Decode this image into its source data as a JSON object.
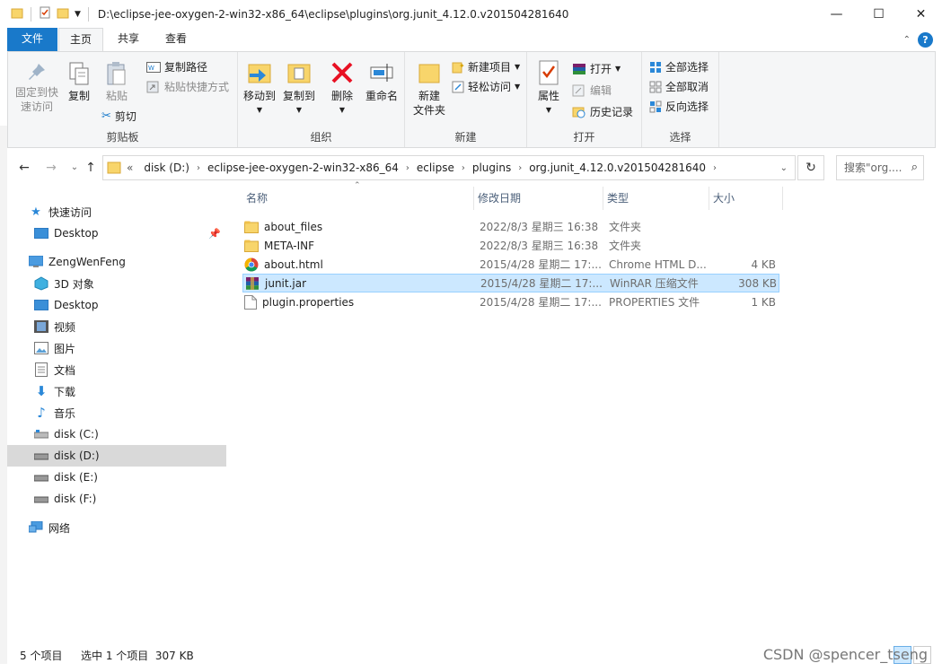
{
  "window": {
    "title_path": "D:\\eclipse-jee-oxygen-2-win32-x86_64\\eclipse\\plugins\\org.junit_4.12.0.v201504281640",
    "minimize": "—",
    "maximize": "☐",
    "close": "✕"
  },
  "tabs": {
    "file": "文件",
    "home": "主页",
    "share": "共享",
    "view": "查看"
  },
  "ribbon": {
    "clipboard": {
      "label": "剪贴板",
      "pin_quick": "固定到快",
      "pin_quick2": "速访问",
      "copy": "复制",
      "paste": "粘贴",
      "copy_path": "复制路径",
      "paste_shortcut": "粘贴快捷方式",
      "cut": "剪切"
    },
    "organize": {
      "label": "组织",
      "move_to": "移动到",
      "copy_to": "复制到",
      "delete": "删除",
      "rename": "重命名"
    },
    "new": {
      "label": "新建",
      "new_folder1": "新建",
      "new_folder2": "文件夹",
      "new_item": "新建项目",
      "easy_access": "轻松访问"
    },
    "open": {
      "label": "打开",
      "properties": "属性",
      "open": "打开",
      "edit": "编辑",
      "history": "历史记录"
    },
    "select": {
      "label": "选择",
      "select_all": "全部选择",
      "select_none": "全部取消",
      "invert": "反向选择"
    }
  },
  "address": {
    "crumbs": [
      "disk (D:)",
      "eclipse-jee-oxygen-2-win32-x86_64",
      "eclipse",
      "plugins",
      "org.junit_4.12.0.v201504281640"
    ],
    "overflow": "«",
    "search_placeholder": "搜索\"org...."
  },
  "nav": {
    "quick_access": "快速访问",
    "desktop_pinned": "Desktop",
    "user": "ZengWenFeng",
    "objects3d": "3D 对象",
    "desktop": "Desktop",
    "videos": "视频",
    "pictures": "图片",
    "documents": "文档",
    "downloads": "下载",
    "music": "音乐",
    "disk_c": "disk (C:)",
    "disk_d": "disk (D:)",
    "disk_e": "disk (E:)",
    "disk_f": "disk (F:)",
    "network": "网络"
  },
  "columns": {
    "name": "名称",
    "date": "修改日期",
    "type": "类型",
    "size": "大小"
  },
  "files": [
    {
      "name": "about_files",
      "date": "2022/8/3 星期三 16:38",
      "type": "文件夹",
      "size": ""
    },
    {
      "name": "META-INF",
      "date": "2022/8/3 星期三 16:38",
      "type": "文件夹",
      "size": ""
    },
    {
      "name": "about.html",
      "date": "2015/4/28 星期二 17:...",
      "type": "Chrome HTML D...",
      "size": "4 KB"
    },
    {
      "name": "junit.jar",
      "date": "2015/4/28 星期二 17:...",
      "type": "WinRAR 压缩文件",
      "size": "308 KB"
    },
    {
      "name": "plugin.properties",
      "date": "2015/4/28 星期二 17:...",
      "type": "PROPERTIES 文件",
      "size": "1 KB"
    }
  ],
  "status": {
    "count": "5 个项目",
    "selected": "选中 1 个项目  307 KB"
  },
  "watermark": "CSDN @spencer_tseng",
  "colors": {
    "accent": "#1979ca",
    "selection": "#cce8ff",
    "folder": "#f8d56b"
  }
}
